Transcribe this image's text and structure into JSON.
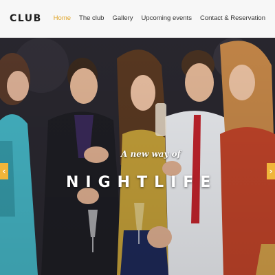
{
  "brand": {
    "logo": "CLUB"
  },
  "nav": {
    "links": [
      {
        "label": "Home",
        "active": true
      },
      {
        "label": "The club",
        "active": false
      },
      {
        "label": "Gallery",
        "active": false
      },
      {
        "label": "Upcoming events",
        "active": false
      },
      {
        "label": "Contact & Reservation",
        "active": false
      }
    ],
    "accent_color": "#e0a52a"
  },
  "hero": {
    "tagline": "A new way of",
    "headline": "NIGHTLIFE",
    "prev_icon": "chevron-left-icon",
    "next_icon": "chevron-right-icon",
    "prev_symbol": "‹",
    "next_symbol": "›",
    "arrow_color": "#f0b53a"
  }
}
